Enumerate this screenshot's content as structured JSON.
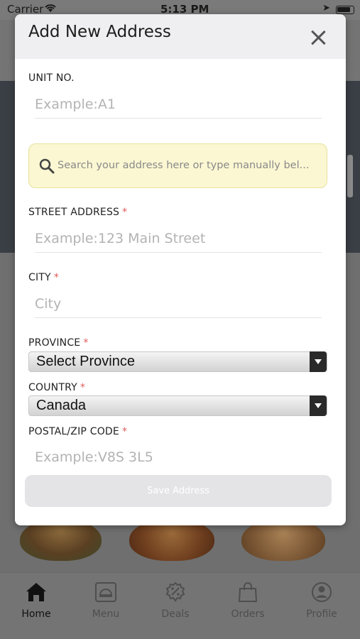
{
  "status_bar": {
    "carrier": "Carrier",
    "time": "5:13 PM",
    "wifi_icon": "wifi-icon",
    "location_icon": "location-arrow-icon",
    "battery_icon": "battery-icon"
  },
  "modal": {
    "title": "Add New Address",
    "close_icon": "close-icon",
    "unit": {
      "label": "UNIT NO.",
      "placeholder": "Example:A1",
      "value": ""
    },
    "search": {
      "placeholder": "Search your address here or type manually bel...",
      "icon": "search-icon"
    },
    "street": {
      "label": "STREET ADDRESS",
      "required_mark": "*",
      "placeholder": "Example:123 Main Street",
      "value": ""
    },
    "city": {
      "label": "CITY",
      "required_mark": "*",
      "placeholder": "City",
      "value": ""
    },
    "province": {
      "label": "PROVINCE",
      "required_mark": "*",
      "selected": "Select Province"
    },
    "country": {
      "label": "COUNTRY",
      "required_mark": "*",
      "selected": "Canada"
    },
    "postal": {
      "label": "POSTAL/ZIP CODE",
      "required_mark": "*",
      "placeholder": "Example:V8S 3L5",
      "value": ""
    },
    "save_label": "Save Address",
    "colors": {
      "search_bg": "#fbf7d2",
      "required": "#e05a5a",
      "save_bg": "#e4e4e6"
    }
  },
  "tab_bar": {
    "items": [
      {
        "label": "Home",
        "icon": "home-icon",
        "active": true
      },
      {
        "label": "Menu",
        "icon": "menu-cloche-icon",
        "active": false
      },
      {
        "label": "Deals",
        "icon": "deals-percent-icon",
        "active": false
      },
      {
        "label": "Orders",
        "icon": "orders-bag-icon",
        "active": false
      },
      {
        "label": "Profile",
        "icon": "profile-icon",
        "active": false
      }
    ]
  }
}
